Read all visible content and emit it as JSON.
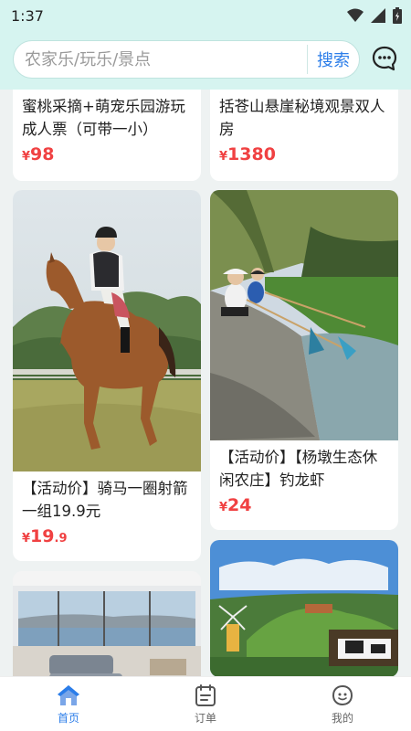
{
  "status_bar": {
    "time": "1:37",
    "icons": [
      "wifi-icon",
      "signal-icon",
      "battery-icon"
    ]
  },
  "search": {
    "placeholder": "农家乐/玩乐/景点",
    "value": "",
    "button_label": "搜索",
    "message_icon": "chat-bubble-icon"
  },
  "colors": {
    "accent": "#2b7de9",
    "price": "#f04142",
    "header_bg": "#d6f4f0"
  },
  "feed": {
    "cards": [
      {
        "title": "蜜桃采摘+萌宠乐园游玩成人票（可带一小）",
        "currency": "¥",
        "price_int": "98",
        "price_dec": "",
        "image": "peach-picking-photo"
      },
      {
        "title": "括苍山悬崖秘境观景双人房",
        "currency": "¥",
        "price_int": "1380",
        "price_dec": "",
        "image": "cliff-room-photo"
      },
      {
        "title": "【活动价】骑马一圈射箭一组19.9元",
        "currency": "¥",
        "price_int": "19",
        "price_dec": ".9",
        "image": "horse-riding-photo"
      },
      {
        "title": "【活动价】【杨墩生态休闲农庄】钓龙虾",
        "currency": "¥",
        "price_int": "24",
        "price_dec": "",
        "image": "crayfish-fishing-photo"
      },
      {
        "title": "",
        "image": "seaview-living-room-photo"
      },
      {
        "title": "",
        "image": "farm-windmill-photo"
      }
    ]
  },
  "tabs": [
    {
      "label": "首页",
      "icon": "home-icon",
      "active": true
    },
    {
      "label": "订单",
      "icon": "orders-icon",
      "active": false
    },
    {
      "label": "我的",
      "icon": "profile-icon",
      "active": false
    }
  ]
}
